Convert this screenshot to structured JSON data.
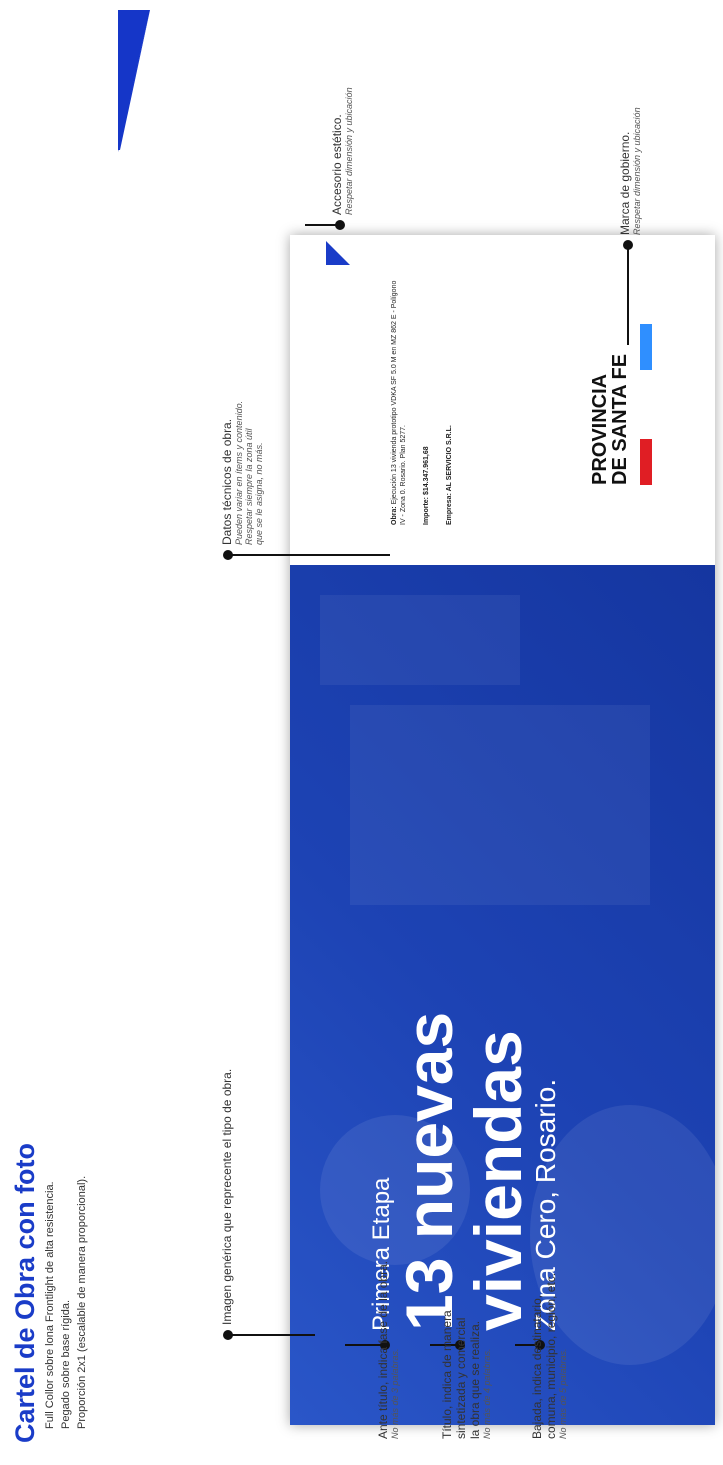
{
  "header": {
    "title": "Cartel de Obra con foto",
    "line1": "Full Collor sobre lona Frontlight de alta resistencia.",
    "line2": "Pegado sobre base rígida.",
    "line3": "Proporción 2x1 (escalable de manera proporcional)."
  },
  "sign": {
    "pretitle": "Primera Etapa",
    "title_line1": "13 nuevas",
    "title_line2": "viviendas",
    "subtitle": "Zona Cero, Rosario.",
    "tech": {
      "obra_label": "Obra:",
      "obra_text": "Ejecución 13 vivienda prototipo VDKA SF 5.0 M en MZ 862 E - Polígono IV - Zona 0. Rosario. Plan 5277.",
      "importe": "Importe: $14.347.961,68",
      "empresa": "Empresa: AL SERVICIO S.R.L."
    },
    "logo": {
      "line1": "PROVINCIA",
      "line2": "DE SANTA FE"
    }
  },
  "annotations": {
    "pretitle": {
      "main": "Ante título, indica fase de la obra.",
      "note": "No más de 3 palabras."
    },
    "title": {
      "line1": "Título, indica de manera",
      "line2": "sintetizada y comercial",
      "line3": "la obra que se realiza.",
      "note": "No más de 4 palabras."
    },
    "subtitle": {
      "line1": "Bajada, indica destinatario,",
      "line2": "comuna, municipio, región, etc.",
      "note": "No más de 5 palabras."
    },
    "image": {
      "main": "Imagen genérica que reprecente el tipo de obra."
    },
    "tech": {
      "main": "Datos técnicos de obra.",
      "note1": "Pueden variar en ítems y contenido.",
      "note2": "Respetar siempre la zona útil",
      "note3": "que se le asigna, no más."
    },
    "accessory": {
      "main": "Accesorio estético.",
      "note": "Respetar dimensión y ubicación"
    },
    "brand": {
      "main": "Marca de gobierno.",
      "note": "Respetar dimensión y ubicación"
    }
  },
  "colors": {
    "brand_blue": "#1a3cc8",
    "photo_blue": "#1d43b4",
    "flag_red": "#e01e24",
    "flag_blue": "#2f8fff"
  }
}
